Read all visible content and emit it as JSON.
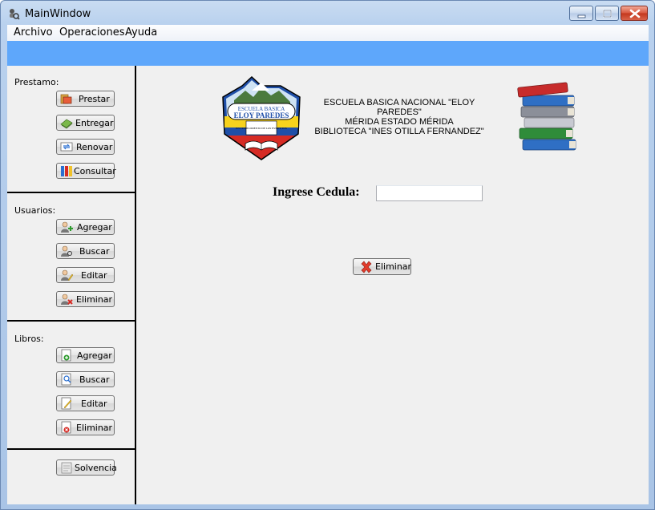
{
  "window": {
    "title": "MainWindow"
  },
  "menu": {
    "items": [
      "Archivo",
      "Operaciones",
      "Ayuda"
    ]
  },
  "sidebar": {
    "prestamo": {
      "label": "Prestamo:",
      "buttons": [
        "Prestar",
        "Entregar",
        "Renovar",
        "Consultar"
      ]
    },
    "usuarios": {
      "label": "Usuarios:",
      "buttons": [
        "Agregar",
        "Buscar",
        "Editar",
        "Eliminar"
      ]
    },
    "libros": {
      "label": "Libros:",
      "buttons": [
        "Agregar",
        "Buscar",
        "Editar",
        "Eliminar"
      ]
    },
    "solvencia": "Solvencia"
  },
  "header": {
    "logo": {
      "line1": "ESCUELA BASICA",
      "line2": "ELOY PAREDES",
      "motto": "EN CUMPLIMIENTO DE LOS ESTATUTOS",
      "colors": {
        "yellow": "#f6d21d",
        "blue": "#1f4fa8",
        "red": "#d62b24",
        "green": "#2f8c3a"
      }
    },
    "school_lines": [
      "ESCUELA BASICA NACIONAL \"ELOY PAREDES\"",
      "MÉRIDA ESTADO MÉRIDA",
      "BIBLIOTECA \"INES OTILLA FERNANDEZ\""
    ]
  },
  "form": {
    "cedula_label": "Ingrese Cedula:",
    "cedula_value": "",
    "delete_button": "Eliminar"
  },
  "colors": {
    "accent_bar": "#5ea7fb",
    "client_bg": "#f0f0f0"
  }
}
